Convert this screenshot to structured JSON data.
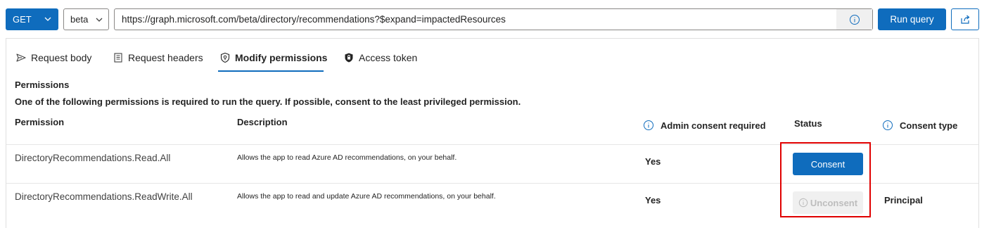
{
  "toolbar": {
    "method": "GET",
    "version": "beta",
    "url": "https://graph.microsoft.com/beta/directory/recommendations?$expand=impactedResources",
    "run_label": "Run query"
  },
  "tabs": [
    {
      "label": "Request body",
      "icon": "send-icon"
    },
    {
      "label": "Request headers",
      "icon": "document-icon"
    },
    {
      "label": "Modify permissions",
      "icon": "shield-key-icon",
      "selected": true
    },
    {
      "label": "Access token",
      "icon": "lock-shield-icon"
    }
  ],
  "permissions": {
    "title": "Permissions",
    "note": "One of the following permissions is required to run the query. If possible, consent to the least privileged permission.",
    "columns": {
      "permission": "Permission",
      "description": "Description",
      "admin": "Admin consent required",
      "status": "Status",
      "consent_type": "Consent type"
    },
    "rows": [
      {
        "permission": "DirectoryRecommendations.Read.All",
        "description": "Allows the app to read Azure AD recommendations, on your behalf.",
        "admin": "Yes",
        "status_button": "Consent",
        "consent_type": ""
      },
      {
        "permission": "DirectoryRecommendations.ReadWrite.All",
        "description": "Allows the app to read and update Azure AD recommendations, on your behalf.",
        "admin": "Yes",
        "status_button": "Unconsent",
        "consent_type": "Principal"
      }
    ]
  },
  "colors": {
    "accent": "#0f6cbd",
    "highlight": "#e00000"
  }
}
